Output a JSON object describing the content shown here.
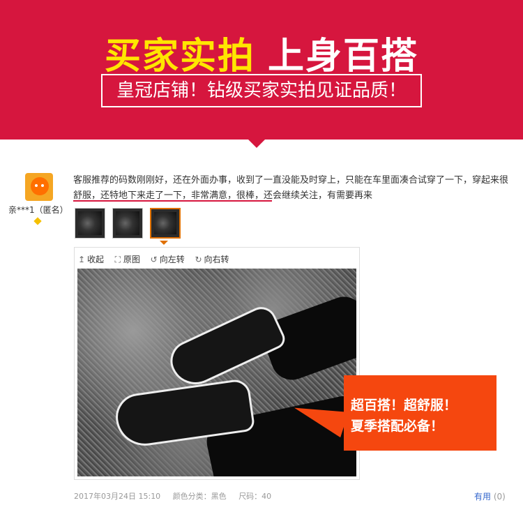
{
  "banner": {
    "title_yellow": "买家实拍",
    "title_white": "上身百搭",
    "subtitle": "皇冠店铺！钻级买家实拍见证品质！",
    "bg_color": "#d6163e"
  },
  "review": {
    "username": "亲***1（匿名）",
    "text": "客服推荐的码数刚刚好，还在外面办事，收到了一直没能及时穿上，只能在车里面凑合试穿了一下，穿起来很舒服，还特地下来走了一下，非常满意，很棒，还会继续关注，有需要再来",
    "thumbnails": [
      {
        "label": "thumb-1"
      },
      {
        "label": "thumb-2"
      },
      {
        "label": "thumb-3"
      }
    ],
    "viewer": {
      "toolbar": {
        "collapse": "收起",
        "original": "原图",
        "rotate_left": "向左转",
        "rotate_right": "向右转"
      }
    },
    "date": "2017年03月24日 15:10",
    "color_label": "颜色分类：黑色",
    "size_label": "尺码：40",
    "useful_label": "有用",
    "useful_count": "(0)"
  },
  "callout": {
    "line1": "超百搭！超舒服！",
    "line2": "夏季搭配必备！",
    "color": "#f5470f"
  }
}
